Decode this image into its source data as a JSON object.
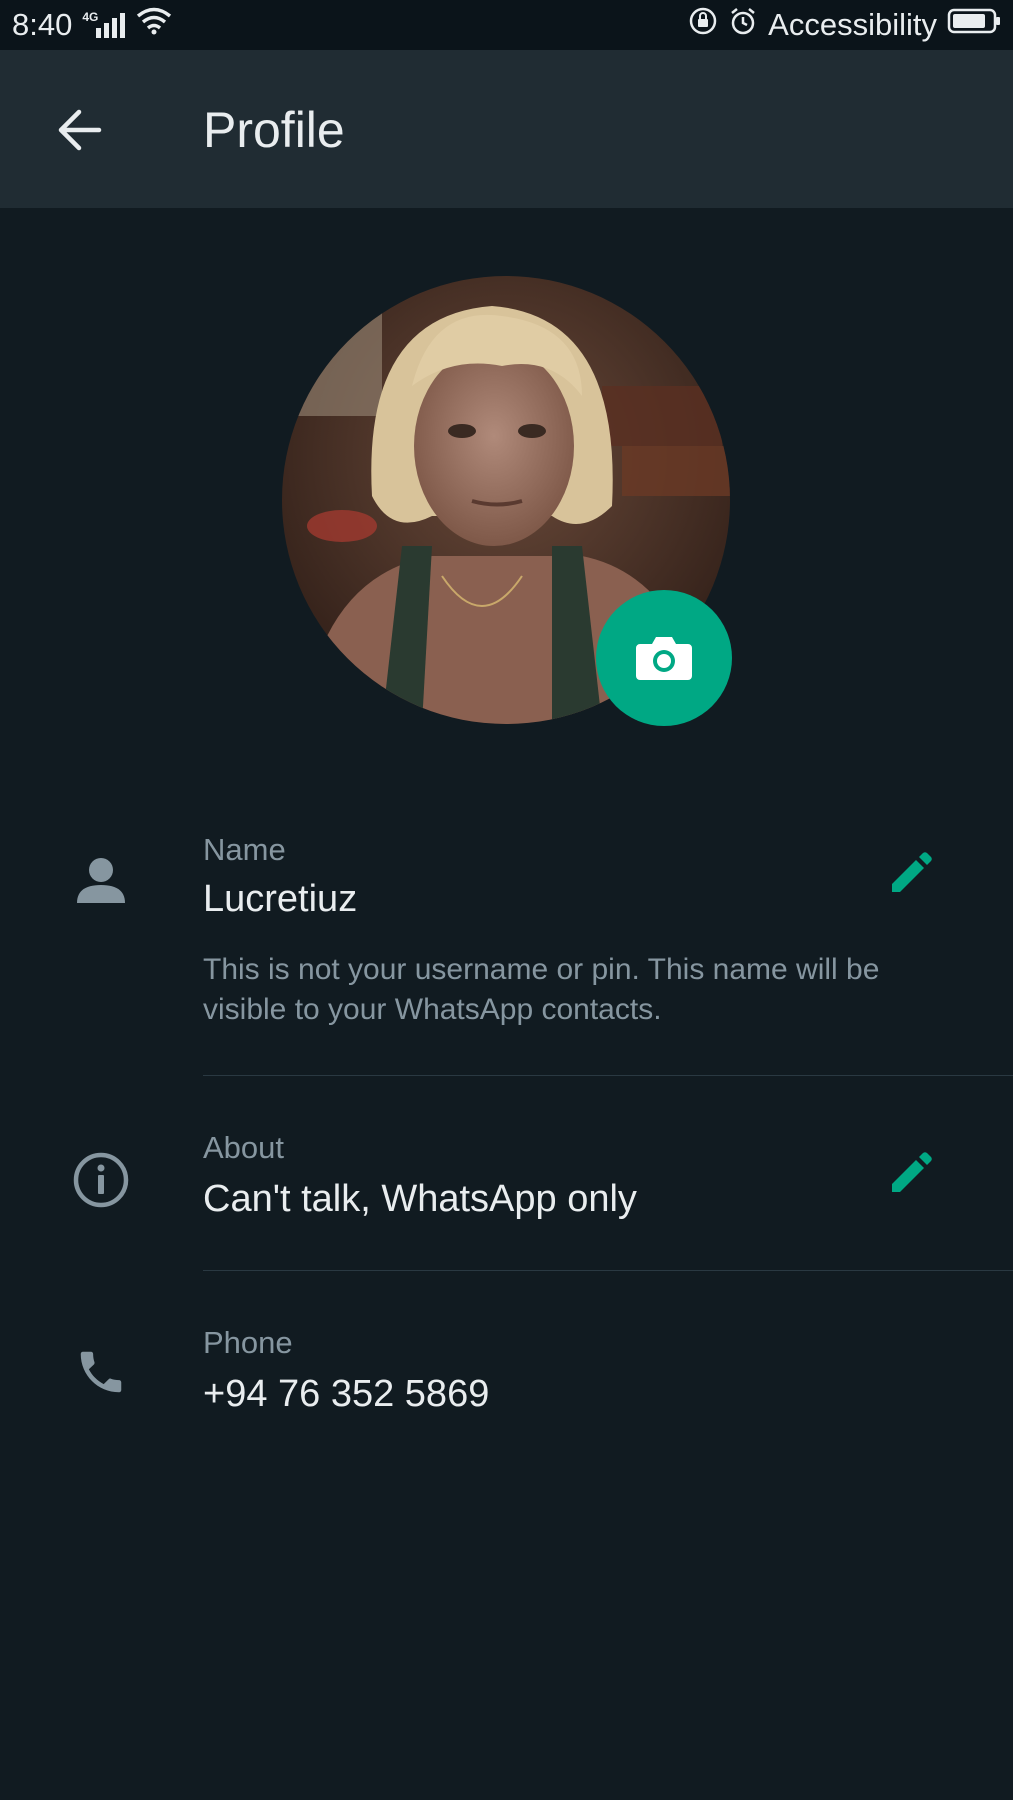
{
  "status_bar": {
    "time": "8:40",
    "network_type": "4G",
    "right_label": "Accessibility",
    "icons": [
      "signal-icon",
      "wifi-icon",
      "rotation-lock-icon",
      "alarm-icon",
      "battery-icon"
    ]
  },
  "header": {
    "title": "Profile",
    "back_icon": "arrow-left-icon"
  },
  "profile": {
    "photo": "profile-photo",
    "camera_icon": "camera-icon",
    "accent_color": "#00a884"
  },
  "fields": {
    "name": {
      "label": "Name",
      "value": "Lucretiuz",
      "note": "This is not your username or pin. This name will be visible to your WhatsApp contacts.",
      "icon": "person-icon",
      "edit_icon": "pencil-icon"
    },
    "about": {
      "label": "About",
      "value": "Can't talk, WhatsApp only",
      "icon": "info-icon",
      "edit_icon": "pencil-icon"
    },
    "phone": {
      "label": "Phone",
      "value": "+94 76 352 5869",
      "icon": "phone-icon"
    }
  },
  "colors": {
    "background": "#111b21",
    "app_bar": "#202c33",
    "text_primary": "#e9edef",
    "text_secondary": "#8696a0",
    "accent": "#00a884"
  }
}
